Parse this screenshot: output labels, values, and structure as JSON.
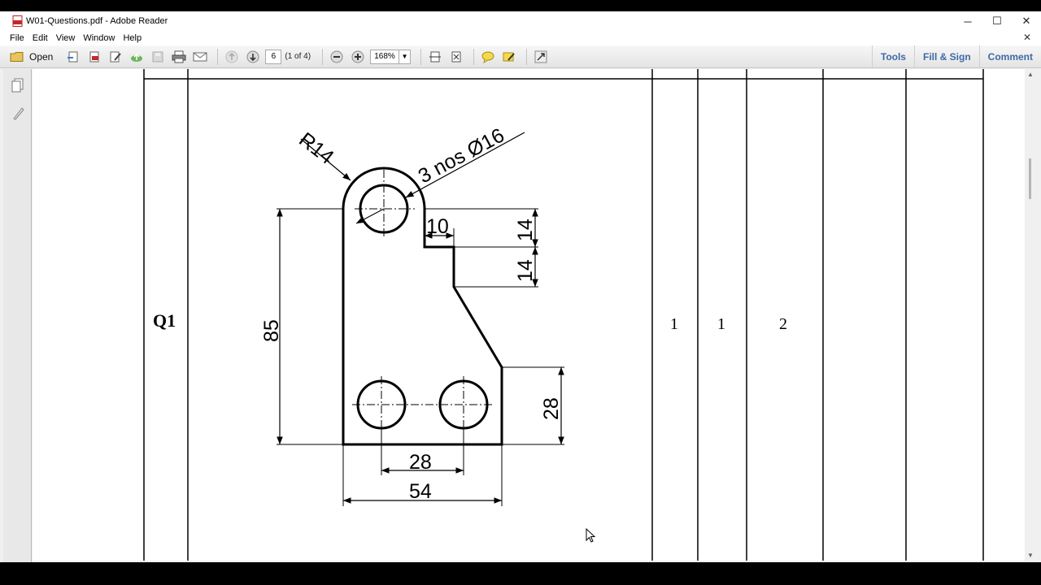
{
  "window": {
    "title": "W01-Questions.pdf - Adobe Reader",
    "controls": {
      "minimize": "─",
      "maximize": "☐",
      "close": "✕"
    }
  },
  "menu": {
    "items": [
      "File",
      "Edit",
      "View",
      "Window",
      "Help"
    ],
    "close": "✕"
  },
  "toolbar": {
    "open_label": "Open",
    "page_number": "6",
    "page_count": "(1 of 4)",
    "zoom": "168%",
    "right_tools": [
      "Tools",
      "Fill & Sign",
      "Comment"
    ]
  },
  "table": {
    "question_label": "Q1",
    "col_values": [
      "1",
      "1",
      "2"
    ]
  },
  "drawing": {
    "radius_label": "R14",
    "holes_label": "3 nos Ø16",
    "dims": {
      "height": "85",
      "notch_width": "10",
      "step1": "14",
      "step2": "14",
      "right_height": "28",
      "hole_spacing": "28",
      "total_width": "54"
    }
  },
  "colors": {
    "accent": "#3e6aa6",
    "window_bg": "#f0f0f0",
    "page_bg": "#ffffff"
  }
}
